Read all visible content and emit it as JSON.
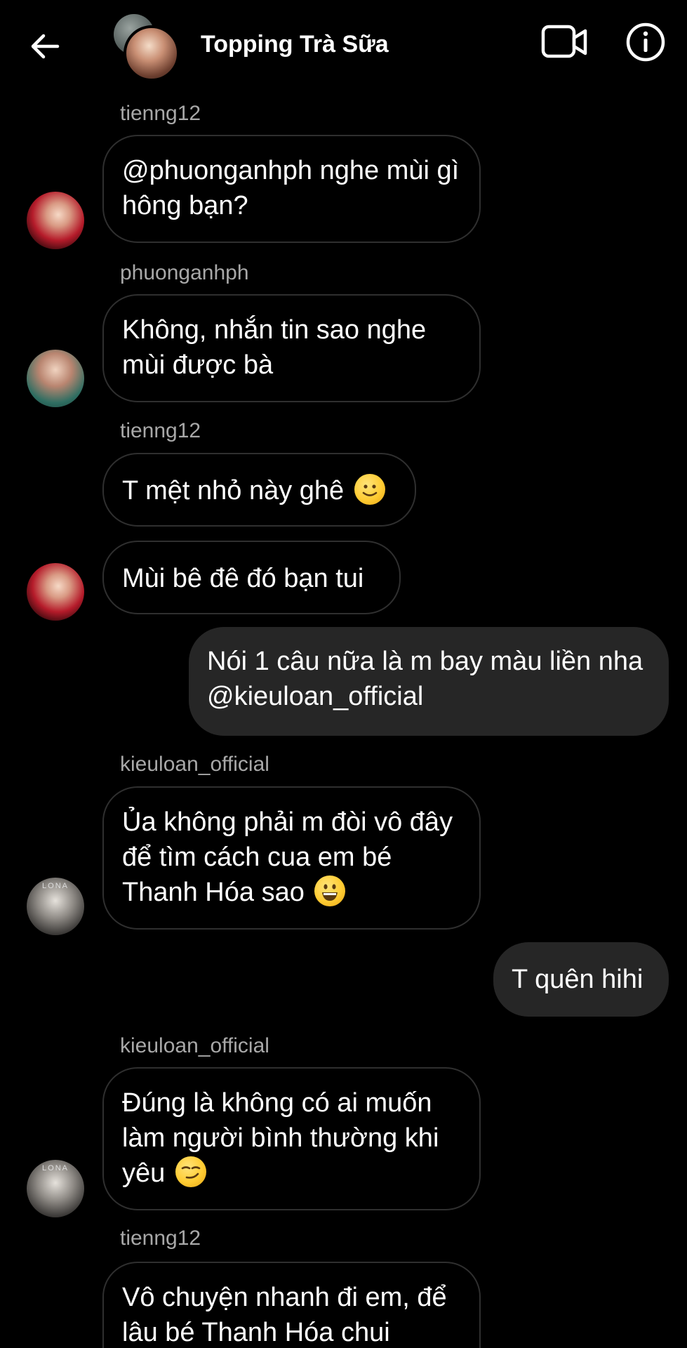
{
  "header": {
    "title": "Topping Trà Sữa"
  },
  "messages": [
    {
      "sender": "tienng12",
      "text": "@phuonganhph nghe mùi gì hông bạn?"
    },
    {
      "sender": "phuonganhph",
      "text": "Không, nhắn tin sao nghe mùi được bà"
    },
    {
      "sender": "tienng12",
      "text": "T mệt nhỏ này ghê",
      "emoji": "slightly-smiling-face"
    },
    {
      "text": "Mùi bê đê đó bạn tui"
    },
    {
      "outgoing": true,
      "text": "Nói 1 câu nữa là m bay màu liền nha @kieuloan_official"
    },
    {
      "sender": "kieuloan_official",
      "text": "Ủa không phải m đòi vô đây để tìm cách cua em bé Thanh Hóa sao",
      "emoji": "grinning-face"
    },
    {
      "outgoing": true,
      "text": "T quên hihi"
    },
    {
      "sender": "kieuloan_official",
      "text": "Đúng là không có ai muốn làm người bình thường khi yêu",
      "emoji": "smirking-face"
    },
    {
      "sender": "tienng12",
      "text": "Vô chuyện nhanh đi em, để lâu bé Thanh Hóa chui"
    }
  ],
  "avatars": {
    "kieuloan_label": "LONA"
  },
  "icons": [
    "back-arrow-icon",
    "video-call-icon",
    "info-icon"
  ]
}
